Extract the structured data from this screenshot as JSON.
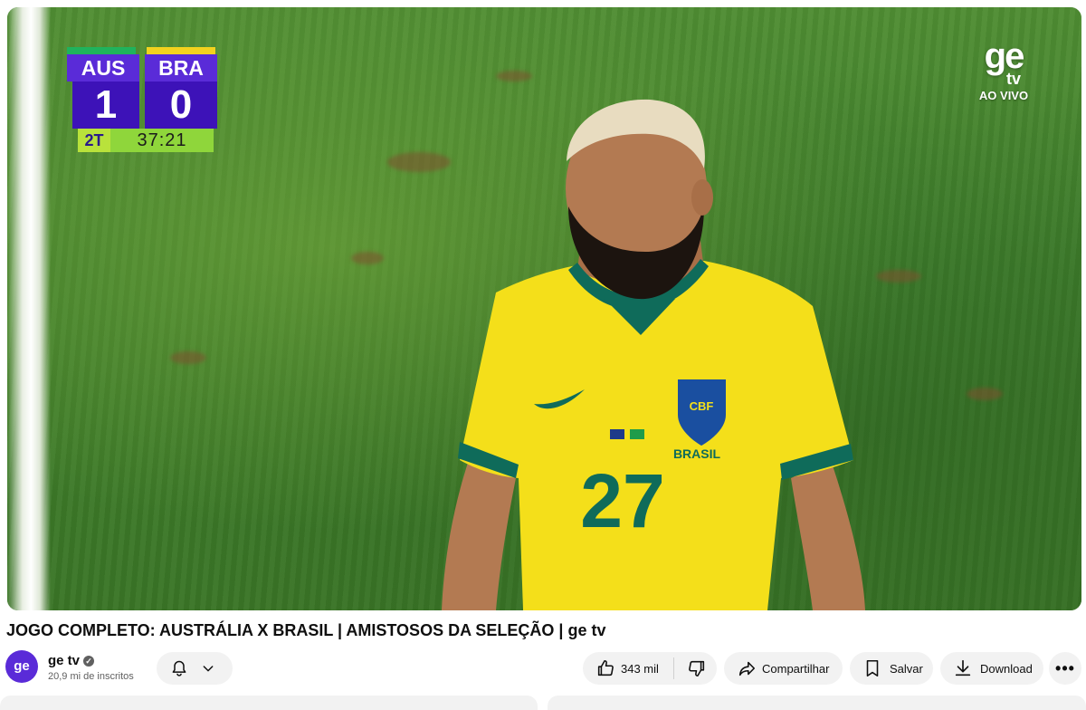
{
  "video": {
    "scoreboard": {
      "home_team": "AUS",
      "away_team": "BRA",
      "home_score": "1",
      "away_score": "0",
      "period": "2T",
      "clock": "37:21"
    },
    "watermark": {
      "logo": "ge",
      "tv": "tv",
      "status": "AO VIVO"
    },
    "jersey": {
      "crest": "CBF",
      "team": "BRASIL",
      "number": "27"
    }
  },
  "title": "JOGO COMPLETO: AUSTRÁLIA X BRASIL | AMISTOSOS DA SELEÇÃO | ge tv",
  "channel": {
    "avatar_text": "ge",
    "name": "ge tv",
    "subscribers": "20,9 mi de inscritos"
  },
  "actions": {
    "likes": "343 mil",
    "share": "Compartilhar",
    "save": "Salvar",
    "download": "Download",
    "more": "•••"
  },
  "icons": [
    "bell-icon",
    "chevron-down-icon",
    "thumbs-up-icon",
    "thumbs-down-icon",
    "share-icon",
    "bookmark-icon",
    "download-icon",
    "more-icon",
    "verified-icon"
  ],
  "colors": {
    "scoreboard_purple": "#5a2bd8",
    "scoreboard_green": "#8fd63b",
    "pill_bg": "#f2f2f2",
    "jersey_yellow": "#f4df1a",
    "jersey_trim": "#0f6b5a"
  }
}
